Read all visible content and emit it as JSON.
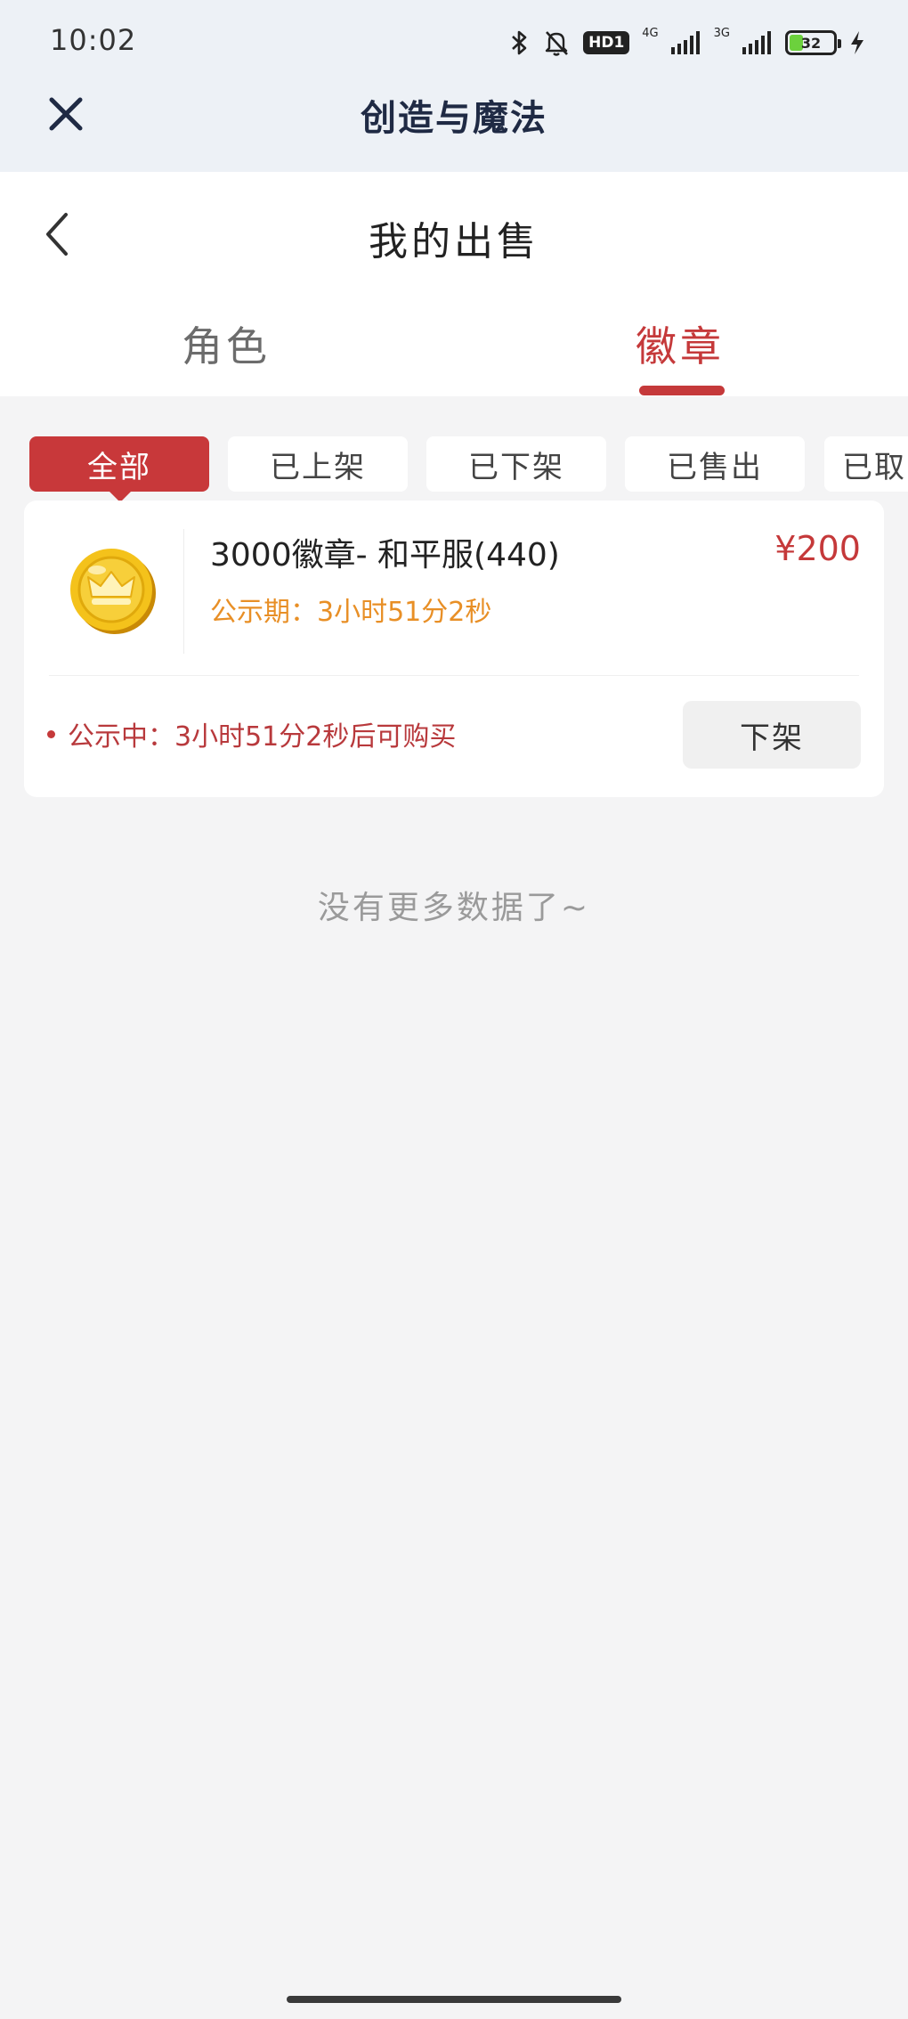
{
  "status_bar": {
    "time": "10:02",
    "hd_badge": "HD1",
    "net_4g": "4G",
    "net_3g": "3G",
    "battery_level": "32",
    "icons": [
      "bluetooth-icon",
      "bell-muted-icon",
      "signal-icon",
      "battery-icon",
      "charging-icon"
    ]
  },
  "app_header": {
    "title": "创造与魔法",
    "close_icon": "close-icon"
  },
  "page_header": {
    "title": "我的出售",
    "back_icon": "chevron-left-icon"
  },
  "tabs": [
    {
      "label": "角色",
      "active": false
    },
    {
      "label": "徽章",
      "active": true
    }
  ],
  "filter_chips": [
    {
      "label": "全部",
      "active": true
    },
    {
      "label": "已上架",
      "active": false
    },
    {
      "label": "已下架",
      "active": false
    },
    {
      "label": "已售出",
      "active": false
    },
    {
      "label": "已取",
      "active": false
    }
  ],
  "listing": {
    "name": "3000徽章- 和平服(440)",
    "price": "¥200",
    "period": "公示期：3小时51分2秒",
    "status": "公示中：3小时51分2秒后可购买",
    "action_label": "下架",
    "icon": "gold-crown-coin-icon"
  },
  "footer_text": "没有更多数据了~",
  "colors": {
    "accent_red": "#c5393a",
    "period_orange": "#e88f26",
    "header_bg": "#edf1f6",
    "page_bg": "#f4f4f5"
  }
}
